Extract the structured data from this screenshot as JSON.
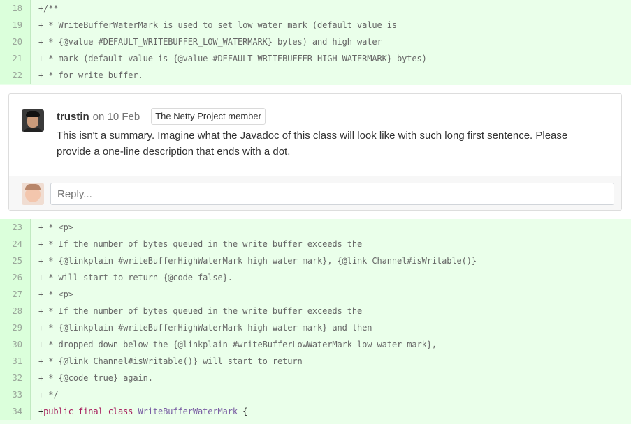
{
  "diff_top": [
    {
      "num": "18",
      "text": "+/**"
    },
    {
      "num": "19",
      "text": "+ * WriteBufferWaterMark is used to set low water mark (default value is"
    },
    {
      "num": "20",
      "text": "+ * {@value #DEFAULT_WRITEBUFFER_LOW_WATERMARK} bytes) and high water"
    },
    {
      "num": "21",
      "text": "+ * mark (default value is {@value #DEFAULT_WRITEBUFFER_HIGH_WATERMARK} bytes)"
    },
    {
      "num": "22",
      "text": "+ * for write buffer."
    }
  ],
  "comment": {
    "author": "trustin",
    "date": "on 10 Feb",
    "badge": "The Netty Project member",
    "text": "This isn't a summary. Imagine what the Javadoc of this class will look like with such long first sentence. Please provide a one-line description that ends with a dot.",
    "reply_placeholder": "Reply..."
  },
  "diff_bottom": [
    {
      "num": "23",
      "text": "+ * <p>"
    },
    {
      "num": "24",
      "text": "+ * If the number of bytes queued in the write buffer exceeds the"
    },
    {
      "num": "25",
      "text": "+ * {@linkplain #writeBufferHighWaterMark high water mark}, {@link Channel#isWritable()}"
    },
    {
      "num": "26",
      "text": "+ * will start to return {@code false}."
    },
    {
      "num": "27",
      "text": "+ * <p>"
    },
    {
      "num": "28",
      "text": "+ * If the number of bytes queued in the write buffer exceeds the"
    },
    {
      "num": "29",
      "text": "+ * {@linkplain #writeBufferHighWaterMark high water mark} and then"
    },
    {
      "num": "30",
      "text": "+ * dropped down below the {@linkplain #writeBufferLowWaterMark low water mark},"
    },
    {
      "num": "31",
      "text": "+ * {@link Channel#isWritable()} will start to return"
    },
    {
      "num": "32",
      "text": "+ * {@code true} again."
    },
    {
      "num": "33",
      "text": "+ */"
    }
  ],
  "last_line": {
    "num": "34",
    "plus": "+",
    "kw1": "public",
    "kw2": "final",
    "kw3": "class",
    "class_name": "WriteBufferWaterMark",
    "brace": "{"
  }
}
